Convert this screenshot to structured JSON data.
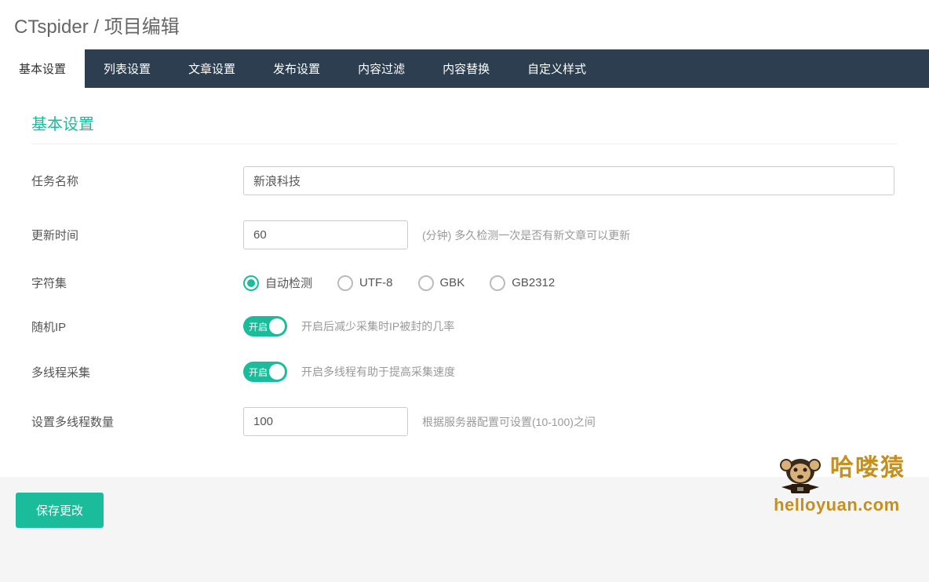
{
  "breadcrumb": {
    "app": "CTspider",
    "sep": "/",
    "page": "项目编辑"
  },
  "tabs": [
    {
      "label": "基本设置",
      "active": true
    },
    {
      "label": "列表设置",
      "active": false
    },
    {
      "label": "文章设置",
      "active": false
    },
    {
      "label": "发布设置",
      "active": false
    },
    {
      "label": "内容过滤",
      "active": false
    },
    {
      "label": "内容替换",
      "active": false
    },
    {
      "label": "自定义样式",
      "active": false
    }
  ],
  "section_title": "基本设置",
  "fields": {
    "task_name": {
      "label": "任务名称",
      "value": "新浪科技"
    },
    "update_interval": {
      "label": "更新时间",
      "value": "60",
      "hint": "(分钟) 多久检测一次是否有新文章可以更新"
    },
    "charset": {
      "label": "字符集",
      "options": [
        {
          "label": "自动检测",
          "checked": true
        },
        {
          "label": "UTF-8",
          "checked": false
        },
        {
          "label": "GBK",
          "checked": false
        },
        {
          "label": "GB2312",
          "checked": false
        }
      ]
    },
    "random_ip": {
      "label": "随机IP",
      "toggle_text": "开启",
      "on": true,
      "hint": "开启后减少采集时IP被封的几率"
    },
    "multithread": {
      "label": "多线程采集",
      "toggle_text": "开启",
      "on": true,
      "hint": "开启多线程有助于提高采集速度"
    },
    "thread_count": {
      "label": "设置多线程数量",
      "value": "100",
      "hint": "根据服务器配置可设置(10-100)之间"
    }
  },
  "save_button": "保存更改",
  "watermark": {
    "cn": "哈喽猿",
    "en": "helloyuan.com"
  }
}
